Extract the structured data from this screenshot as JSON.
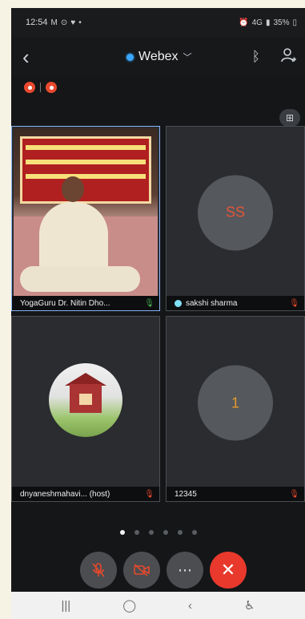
{
  "status_bar": {
    "time": "12:54",
    "left_icons": [
      "gmail-icon",
      "photo-icon",
      "heart-icon",
      "dot-icon"
    ],
    "network": "4G",
    "battery": "35%"
  },
  "header": {
    "title": "Webex",
    "title_color": "#3aa7ff"
  },
  "layout_button": {
    "icon": "grid-icon"
  },
  "participants": [
    {
      "name": "YogaGuru Dr. Nitin Dho...",
      "type": "video",
      "mic": "on"
    },
    {
      "name": "sakshi sharma",
      "type": "avatar",
      "initials": "SS",
      "mic": "muted"
    },
    {
      "name": "dnyaneshmahavi... (host)",
      "type": "photo",
      "mic": "muted"
    },
    {
      "name": "12345",
      "type": "avatar",
      "initials": "1",
      "mic": "muted"
    }
  ],
  "pagination": {
    "pages": 6,
    "active": 0
  },
  "controls": {
    "mute": "mic-off-icon",
    "video": "video-off-icon",
    "more": "⋯",
    "leave": "✕"
  },
  "navbar": [
    "recent-apps-icon",
    "home-icon",
    "back-icon",
    "accessibility-icon"
  ],
  "colors": {
    "accent_red": "#e8392c",
    "mic_muted": "#e8492d",
    "background": "#141618"
  }
}
